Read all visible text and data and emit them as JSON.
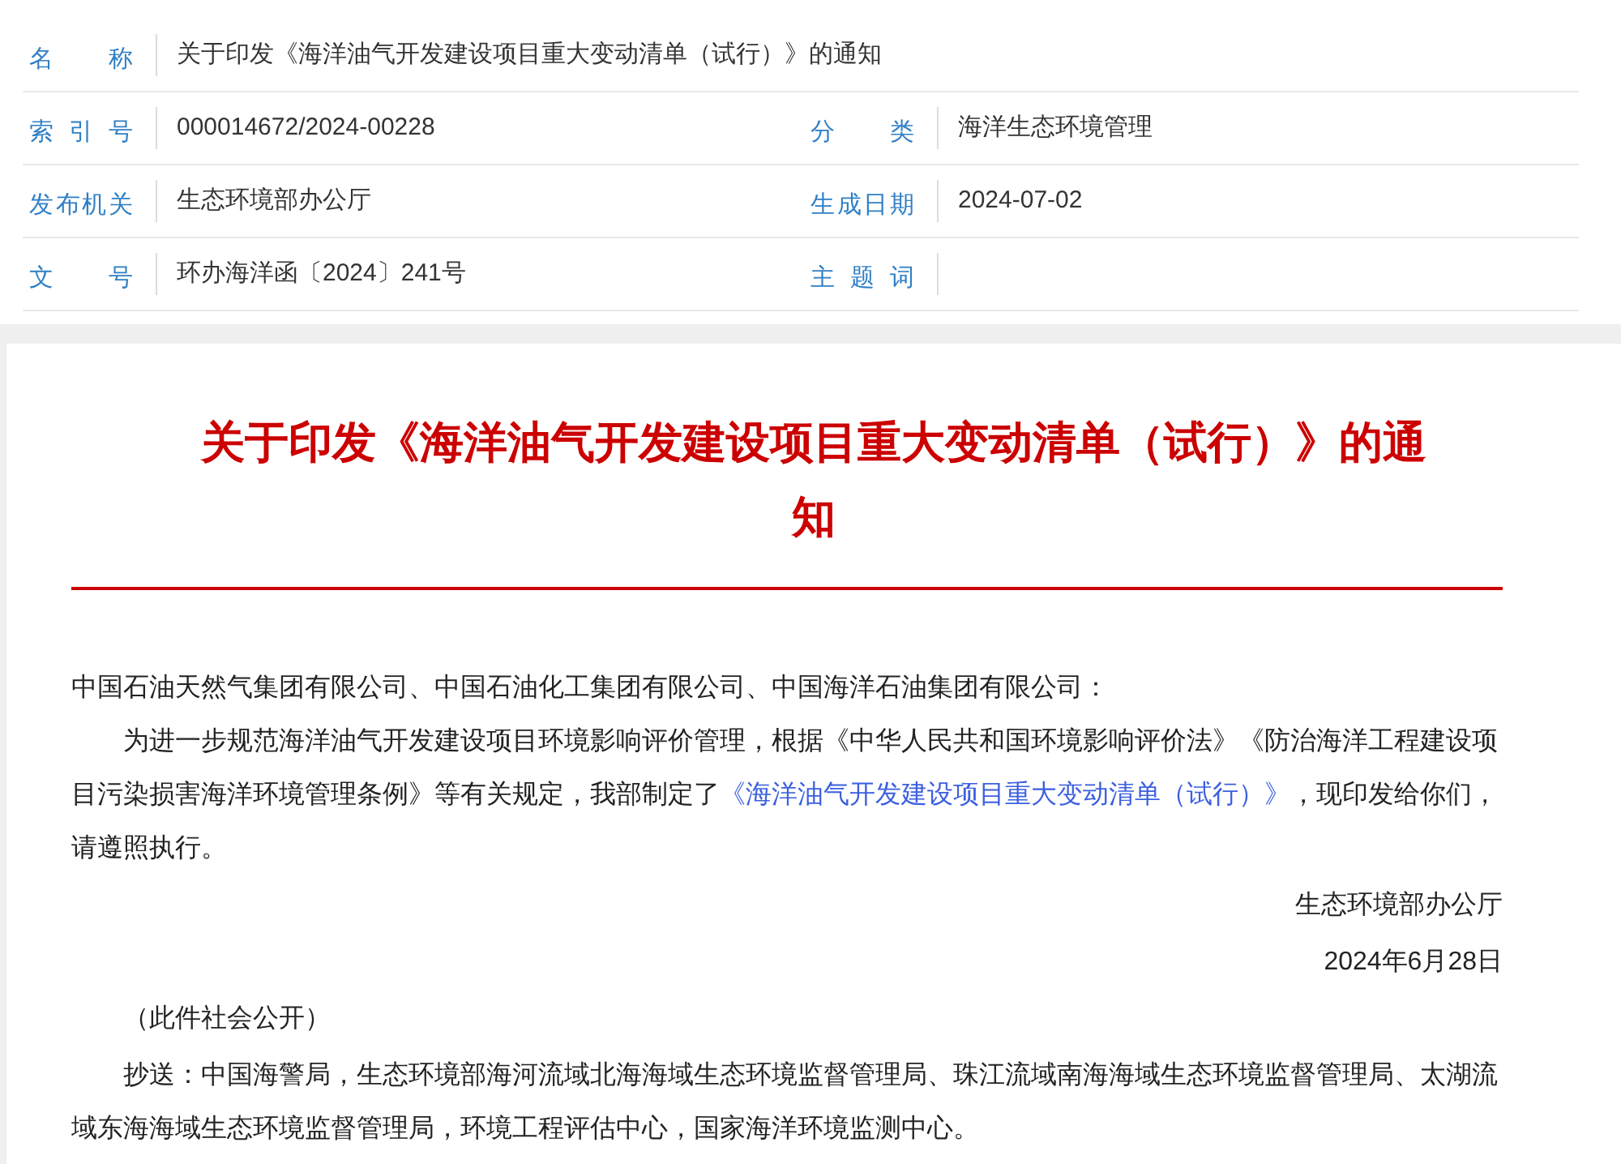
{
  "meta": {
    "rows": [
      {
        "cells": [
          {
            "label": "名称",
            "value": "关于印发《海洋油气开发建设项目重大变动清单（试行）》的通知"
          }
        ]
      },
      {
        "cells": [
          {
            "label": "索引号",
            "value": "000014672/2024-00228"
          },
          {
            "label": "分类",
            "value": "海洋生态环境管理"
          }
        ]
      },
      {
        "cells": [
          {
            "label": "发布机关",
            "value": "生态环境部办公厅"
          },
          {
            "label": "生成日期",
            "value": "2024-07-02"
          }
        ]
      },
      {
        "cells": [
          {
            "label": "文号",
            "value": "环办海洋函〔2024〕241号"
          },
          {
            "label": "主题词"
          }
        ]
      }
    ]
  },
  "article": {
    "title": "关于印发《海洋油气开发建设项目重大变动清单（试行）》的通知",
    "blocks": [
      {
        "kind": "salutation",
        "text": "中国石油天然气集团有限公司、中国石油化工集团有限公司、中国海洋石油集团有限公司："
      },
      {
        "kind": "paragraph",
        "before": "为进一步规范海洋油气开发建设项目环境影响评价管理，根据《中华人民共和国环境影响评价法》《防治海洋工程建设项目污染损害海洋环境管理条例》等有关规定，我部制定了",
        "link": "《海洋油气开发建设项目重大变动清单（试行）》",
        "after": "，现印发给你们，请遵照执行。"
      },
      {
        "kind": "signature",
        "text": "生态环境部办公厅"
      },
      {
        "kind": "signature",
        "text": "2024年6月28日"
      },
      {
        "kind": "indent",
        "text": "（此件社会公开）"
      },
      {
        "kind": "indent",
        "text": "抄送：中国海警局，生态环境部海河流域北海海域生态环境监督管理局、珠江流域南海海域生态环境监督管理局、太湖流域东海海域生态环境监督管理局，环境工程评估中心，国家海洋环境监测中心。"
      }
    ]
  }
}
